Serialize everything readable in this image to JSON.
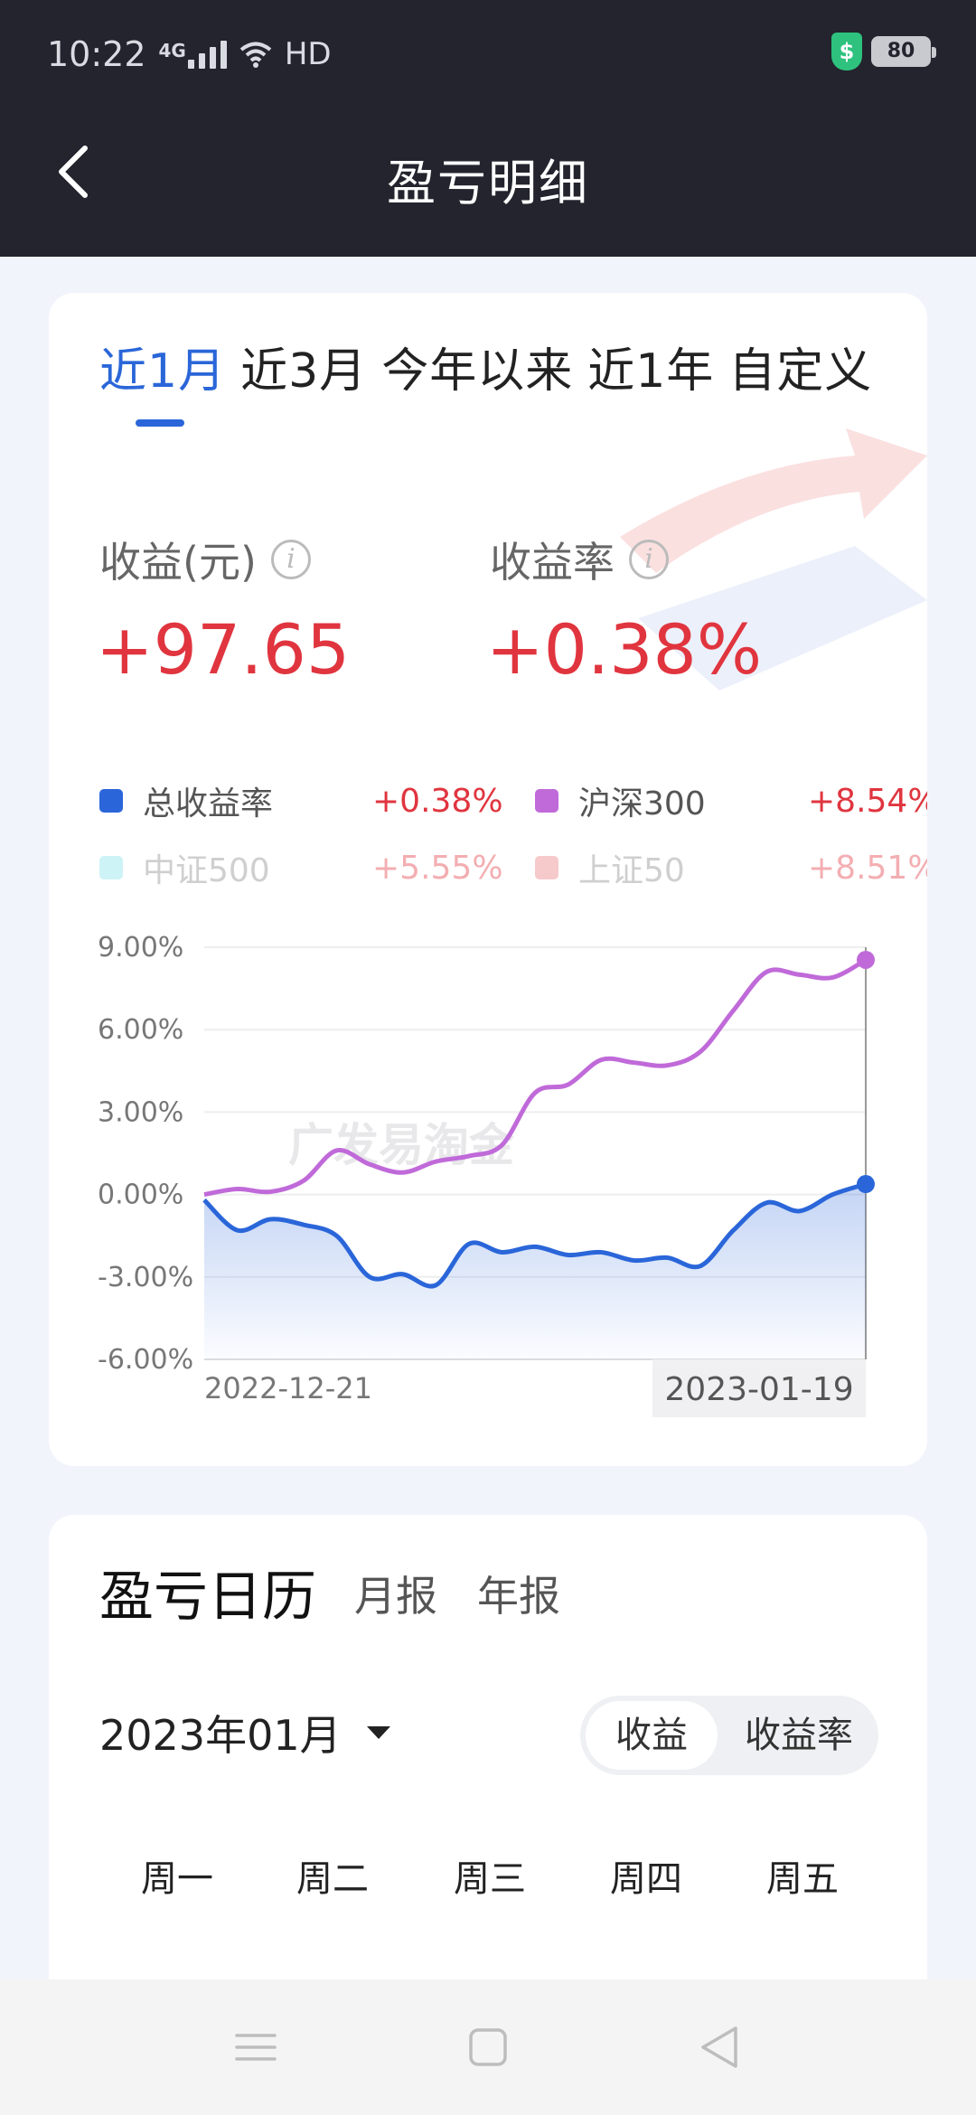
{
  "status_bar": {
    "time": "10:22",
    "network": "4G",
    "hd": "HD",
    "battery": "80"
  },
  "header": {
    "title": "盈亏明细"
  },
  "period_tabs": [
    {
      "label": "近1月",
      "active": true
    },
    {
      "label": "近3月",
      "active": false
    },
    {
      "label": "今年以来",
      "active": false
    },
    {
      "label": "近1年",
      "active": false
    },
    {
      "label": "自定义",
      "active": false
    }
  ],
  "metrics": {
    "profit_label": "收益(元)",
    "profit_value": "+97.65",
    "rate_label": "收益率",
    "rate_value": "+0.38%",
    "info_glyph": "i"
  },
  "legend": [
    {
      "name": "总收益率",
      "value": "+0.38%",
      "color": "#2a66d9",
      "active": true
    },
    {
      "name": "沪深300",
      "value": "+8.54%",
      "color": "#c06ad9",
      "active": true
    },
    {
      "name": "中证500",
      "value": "+5.55%",
      "color": "#cdf3f7",
      "active": false
    },
    {
      "name": "上证50",
      "value": "+8.51%",
      "color": "#f6c9ca",
      "active": false
    }
  ],
  "chart_data": {
    "type": "line",
    "ylim": [
      -6,
      9
    ],
    "y_ticks": [
      "9.00%",
      "6.00%",
      "3.00%",
      "0.00%",
      "-3.00%",
      "-6.00%"
    ],
    "x_start_label": "2022-12-21",
    "x_end_label": "2023-01-19",
    "watermark": "广发易淘金",
    "series": [
      {
        "name": "总收益率",
        "color": "#2a66d9",
        "values": [
          -0.2,
          -1.3,
          -0.9,
          -1.1,
          -1.5,
          -3.0,
          -2.9,
          -3.3,
          -1.8,
          -2.1,
          -1.9,
          -2.2,
          -2.1,
          -2.4,
          -2.3,
          -2.6,
          -1.3,
          -0.3,
          -0.6,
          0.0,
          0.38
        ]
      },
      {
        "name": "沪深300",
        "color": "#c06ad9",
        "values": [
          0.0,
          0.2,
          0.1,
          0.5,
          1.6,
          1.1,
          0.8,
          1.2,
          1.4,
          1.8,
          3.7,
          4.0,
          4.9,
          4.8,
          4.7,
          5.2,
          6.7,
          8.1,
          8.0,
          7.9,
          8.54
        ]
      }
    ]
  },
  "calendar": {
    "title": "盈亏日历",
    "tabs": [
      "月报",
      "年报"
    ],
    "month": "2023年01月",
    "toggle": [
      "收益",
      "收益率"
    ],
    "weekdays": [
      "周一",
      "周二",
      "周三",
      "周四",
      "周五"
    ]
  }
}
